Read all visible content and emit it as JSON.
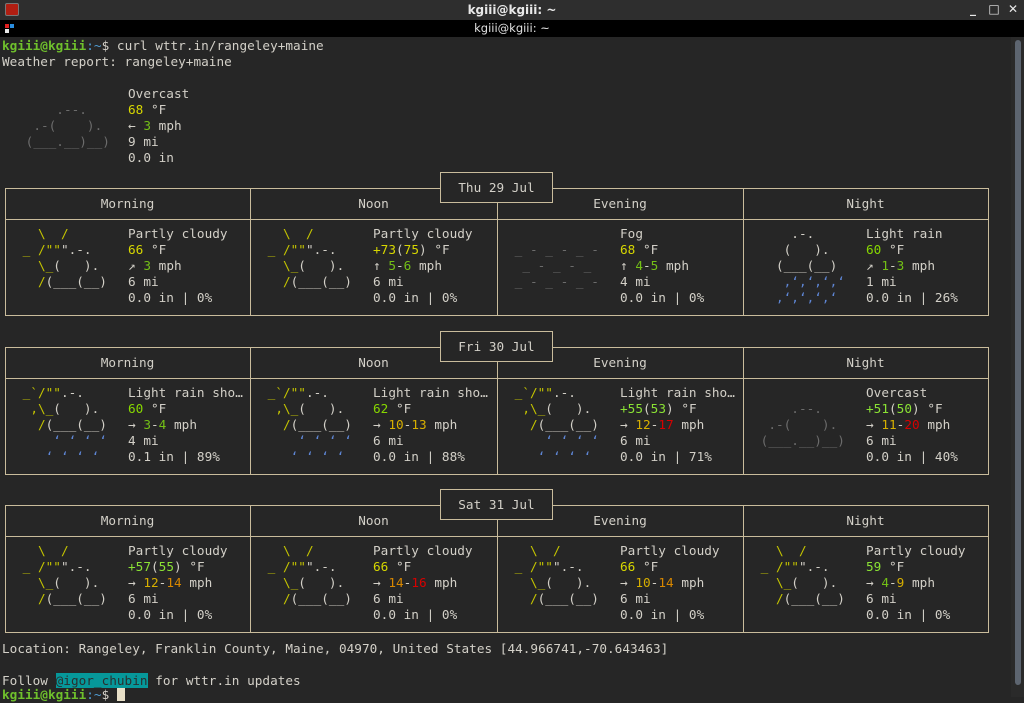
{
  "window": {
    "title": "kgiii@kgiii: ~",
    "tab_title": "kgiii@kgiii: ~",
    "buttons": {
      "minimize": "_",
      "maximize": "□",
      "close": "✕"
    }
  },
  "terminal": {
    "prompt_user": "kgiii@kgiii",
    "prompt_path": ":~",
    "prompt_symbol": "$ ",
    "command": "curl wttr.in/rangeley+maine",
    "report_title": "Weather report: rangeley+maine",
    "current": {
      "condition": "Overcast",
      "temp": "68",
      "temp_unit": " °F",
      "wind_dir": "← ",
      "wind": "3",
      "wind_unit": " mph",
      "visibility": "9 mi",
      "precip": "0.0 in",
      "art": [
        "     .--.    ",
        "  .-(    ).  ",
        " (___.__)__) "
      ]
    },
    "period_labels": [
      "Morning",
      "Noon",
      "Evening",
      "Night"
    ],
    "days": [
      {
        "date": "Thu 29 Jul",
        "periods": [
          {
            "condition": "Partly cloudy",
            "temp": "66",
            "temp_feels": "",
            "temp_unit": " °F",
            "wind_dir": "↗ ",
            "wind_lo": "3",
            "wind_hi": "",
            "wind_unit": " mph",
            "visibility": "6 mi",
            "precip": "0.0 in | 0%",
            "icon": "partly-cloudy"
          },
          {
            "condition": "Partly cloudy",
            "temp": "+73",
            "temp_feels": "(75)",
            "temp_unit": " °F",
            "wind_dir": "↑ ",
            "wind_lo": "5",
            "wind_hi": "6",
            "wind_unit": " mph",
            "visibility": "6 mi",
            "precip": "0.0 in | 0%",
            "icon": "partly-cloudy"
          },
          {
            "condition": "Fog",
            "temp": "68",
            "temp_feels": "",
            "temp_unit": " °F",
            "wind_dir": "↑ ",
            "wind_lo": "4",
            "wind_hi": "5",
            "wind_unit": " mph",
            "visibility": "4 mi",
            "precip": "0.0 in | 0%",
            "icon": "fog"
          },
          {
            "condition": "Light rain",
            "temp": "60",
            "temp_feels": "",
            "temp_unit": " °F",
            "wind_dir": "↗ ",
            "wind_lo": "1",
            "wind_hi": "3",
            "wind_unit": " mph",
            "visibility": "1 mi",
            "precip": "0.0 in | 26%",
            "icon": "light-rain"
          }
        ]
      },
      {
        "date": "Fri 30 Jul",
        "periods": [
          {
            "condition": "Light rain sho…",
            "temp": "60",
            "temp_feels": "",
            "temp_unit": " °F",
            "wind_dir": "→ ",
            "wind_lo": "3",
            "wind_hi": "4",
            "wind_unit": " mph",
            "visibility": "4 mi",
            "precip": "0.1 in | 89%",
            "icon": "light-rain-shower"
          },
          {
            "condition": "Light rain sho…",
            "temp": "62",
            "temp_feels": "",
            "temp_unit": " °F",
            "wind_dir": "→ ",
            "wind_lo": "10",
            "wind_hi": "13",
            "wind_unit": " mph",
            "visibility": "6 mi",
            "precip": "0.0 in | 88%",
            "icon": "light-rain-shower"
          },
          {
            "condition": "Light rain sho…",
            "temp": "+55",
            "temp_feels": "(53)",
            "temp_unit": " °F",
            "wind_dir": "→ ",
            "wind_lo": "12",
            "wind_hi": "17",
            "wind_unit": " mph",
            "visibility": "6 mi",
            "precip": "0.0 in | 71%",
            "icon": "light-rain-shower"
          },
          {
            "condition": "Overcast",
            "temp": "+51",
            "temp_feels": "(50)",
            "temp_unit": " °F",
            "wind_dir": "→ ",
            "wind_lo": "11",
            "wind_hi": "20",
            "wind_unit": " mph",
            "visibility": "6 mi",
            "precip": "0.0 in | 40%",
            "icon": "overcast"
          }
        ]
      },
      {
        "date": "Sat 31 Jul",
        "periods": [
          {
            "condition": "Partly cloudy",
            "temp": "+57",
            "temp_feels": "(55)",
            "temp_unit": " °F",
            "wind_dir": "→ ",
            "wind_lo": "12",
            "wind_hi": "14",
            "wind_unit": " mph",
            "visibility": "6 mi",
            "precip": "0.0 in | 0%",
            "icon": "partly-cloudy"
          },
          {
            "condition": "Partly cloudy",
            "temp": "66",
            "temp_feels": "",
            "temp_unit": " °F",
            "wind_dir": "→ ",
            "wind_lo": "14",
            "wind_hi": "16",
            "wind_unit": " mph",
            "visibility": "6 mi",
            "precip": "0.0 in | 0%",
            "icon": "partly-cloudy"
          },
          {
            "condition": "Partly cloudy",
            "temp": "66",
            "temp_feels": "",
            "temp_unit": " °F",
            "wind_dir": "→ ",
            "wind_lo": "10",
            "wind_hi": "14",
            "wind_unit": " mph",
            "visibility": "6 mi",
            "precip": "0.0 in | 0%",
            "icon": "partly-cloudy"
          },
          {
            "condition": "Partly cloudy",
            "temp": "59",
            "temp_feels": "",
            "temp_unit": " °F",
            "wind_dir": "→ ",
            "wind_lo": "4",
            "wind_hi": "9",
            "wind_unit": " mph",
            "visibility": "6 mi",
            "precip": "0.0 in | 0%",
            "icon": "partly-cloudy"
          }
        ]
      }
    ],
    "location": "Location: Rangeley, Franklin County, Maine, 04970, United States [44.966741,-70.643463]",
    "follow_prefix": "Follow ",
    "follow_handle": "@igor_chubin",
    "follow_suffix": " for wttr.in updates"
  },
  "colors": {
    "background": "#262626",
    "border": "#c9bc9c",
    "text": "#d3d0c8",
    "handle_highlight": "#06989a"
  }
}
